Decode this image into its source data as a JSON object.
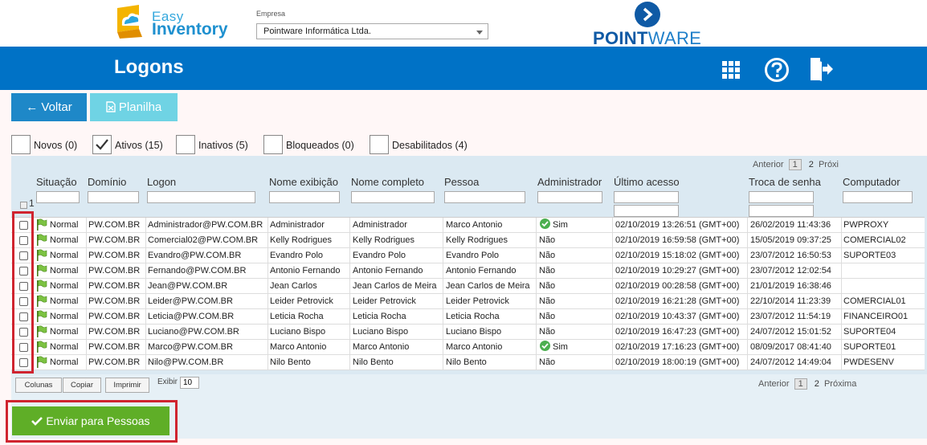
{
  "header": {
    "logo_easy_line1": "Easy",
    "logo_easy_line2": "Inventory",
    "empresa_label": "Empresa",
    "empresa_value": "Pointware Informática Ltda.",
    "logo_pw_bold": "POINT",
    "logo_pw_light": "WARE"
  },
  "page": {
    "title": "Logons",
    "accent": "#0072c6"
  },
  "toolbar": {
    "voltar_label": "Voltar",
    "planilha_label": "Planilha"
  },
  "filters": [
    {
      "label": "Novos (0)",
      "checked": false
    },
    {
      "label": "Ativos (15)",
      "checked": true
    },
    {
      "label": "Inativos (5)",
      "checked": false
    },
    {
      "label": "Bloqueados (0)",
      "checked": false
    },
    {
      "label": "Desabilitados (4)",
      "checked": false
    }
  ],
  "pager_top": {
    "prev": "Anterior",
    "page1": "1",
    "page2": "2",
    "next": "Próxi"
  },
  "select_all_count": "1",
  "columns": [
    "Situação",
    "Domínio",
    "Logon",
    "Nome exibição",
    "Nome completo",
    "Pessoa",
    "Administrador",
    "Último acesso",
    "Troca de senha",
    "Computador"
  ],
  "rows": [
    {
      "situacao": "Normal",
      "dominio": "PW.COM.BR",
      "logon": "Administrador@PW.COM.BR",
      "exibicao": "Administrador",
      "completo": "Administrador",
      "pessoa": "Marco Antonio",
      "admin": "Sim",
      "ultimo": "02/10/2019 13:26:51 (GMT+00)",
      "troca": "26/02/2019 11:43:36",
      "computador": "PWPROXY"
    },
    {
      "situacao": "Normal",
      "dominio": "PW.COM.BR",
      "logon": "Comercial02@PW.COM.BR",
      "exibicao": "Kelly Rodrigues",
      "completo": "Kelly Rodrigues",
      "pessoa": "Kelly Rodrigues",
      "admin": "Não",
      "ultimo": "02/10/2019 16:59:58 (GMT+00)",
      "troca": "15/05/2019 09:37:25",
      "computador": "COMERCIAL02"
    },
    {
      "situacao": "Normal",
      "dominio": "PW.COM.BR",
      "logon": "Evandro@PW.COM.BR",
      "exibicao": "Evandro Polo",
      "completo": "Evandro Polo",
      "pessoa": "Evandro Polo",
      "admin": "Não",
      "ultimo": "02/10/2019 15:18:02 (GMT+00)",
      "troca": "23/07/2012 16:50:53",
      "computador": "SUPORTE03"
    },
    {
      "situacao": "Normal",
      "dominio": "PW.COM.BR",
      "logon": "Fernando@PW.COM.BR",
      "exibicao": "Antonio Fernando",
      "completo": "Antonio Fernando",
      "pessoa": "Antonio Fernando",
      "admin": "Não",
      "ultimo": "02/10/2019 10:29:27 (GMT+00)",
      "troca": "23/07/2012 12:02:54",
      "computador": ""
    },
    {
      "situacao": "Normal",
      "dominio": "PW.COM.BR",
      "logon": "Jean@PW.COM.BR",
      "exibicao": "Jean Carlos",
      "completo": "Jean Carlos de Meira",
      "pessoa": "Jean Carlos de Meira",
      "admin": "Não",
      "ultimo": "02/10/2019 00:28:58 (GMT+00)",
      "troca": "21/01/2019 16:38:46",
      "computador": ""
    },
    {
      "situacao": "Normal",
      "dominio": "PW.COM.BR",
      "logon": "Leider@PW.COM.BR",
      "exibicao": "Leider Petrovick",
      "completo": "Leider Petrovick",
      "pessoa": "Leider Petrovick",
      "admin": "Não",
      "ultimo": "02/10/2019 16:21:28 (GMT+00)",
      "troca": "22/10/2014 11:23:39",
      "computador": "COMERCIAL01"
    },
    {
      "situacao": "Normal",
      "dominio": "PW.COM.BR",
      "logon": "Leticia@PW.COM.BR",
      "exibicao": "Leticia Rocha",
      "completo": "Leticia Rocha",
      "pessoa": "Leticia Rocha",
      "admin": "Não",
      "ultimo": "02/10/2019 10:43:37 (GMT+00)",
      "troca": "23/07/2012 11:54:19",
      "computador": "FINANCEIRO01"
    },
    {
      "situacao": "Normal",
      "dominio": "PW.COM.BR",
      "logon": "Luciano@PW.COM.BR",
      "exibicao": "Luciano Bispo",
      "completo": "Luciano Bispo",
      "pessoa": "Luciano Bispo",
      "admin": "Não",
      "ultimo": "02/10/2019 16:47:23 (GMT+00)",
      "troca": "24/07/2012 15:01:52",
      "computador": "SUPORTE04"
    },
    {
      "situacao": "Normal",
      "dominio": "PW.COM.BR",
      "logon": "Marco@PW.COM.BR",
      "exibicao": "Marco Antonio",
      "completo": "Marco Antonio",
      "pessoa": "Marco Antonio",
      "admin": "Sim",
      "ultimo": "02/10/2019 17:16:23 (GMT+00)",
      "troca": "08/09/2017 08:41:40",
      "computador": "SUPORTE01"
    },
    {
      "situacao": "Normal",
      "dominio": "PW.COM.BR",
      "logon": "Nilo@PW.COM.BR",
      "exibicao": "Nilo Bento",
      "completo": "Nilo Bento",
      "pessoa": "Nilo Bento",
      "admin": "Não",
      "ultimo": "02/10/2019 18:00:19 (GMT+00)",
      "troca": "24/07/2012 14:49:04",
      "computador": "PWDESENV"
    }
  ],
  "bottom": {
    "colunas_label": "Colunas",
    "copiar_label": "Copiar",
    "imprimir_label": "Imprimir",
    "exibir_label": "Exibir",
    "exibir_value": "10",
    "pager_prev": "Anterior",
    "pager_page1": "1",
    "pager_page2": "2",
    "pager_next": "Próxima"
  },
  "enviar_label": "Enviar para Pessoas",
  "icons": [
    "grid-icon",
    "help-icon",
    "logout-icon",
    "arrow-left-icon",
    "spreadsheet-icon",
    "flag-icon",
    "check-icon"
  ]
}
